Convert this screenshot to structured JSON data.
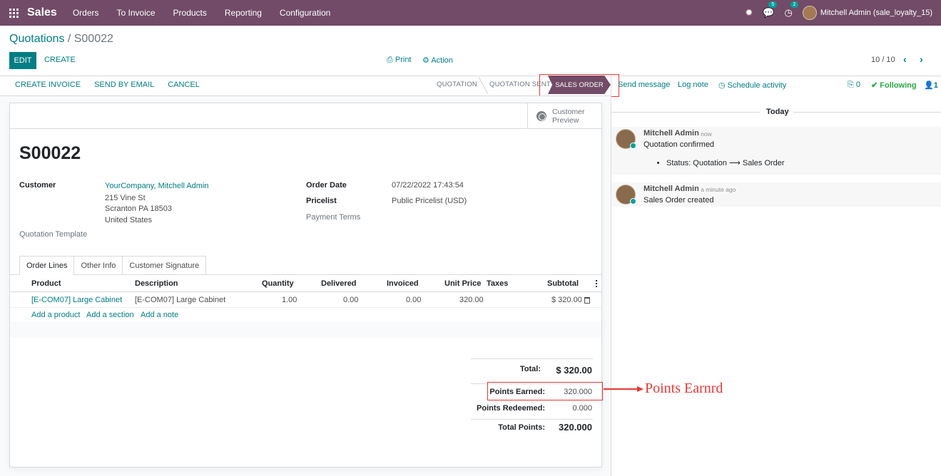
{
  "navbar": {
    "app_name": "Sales",
    "menu": [
      "Orders",
      "To Invoice",
      "Products",
      "Reporting",
      "Configuration"
    ],
    "messages_count": "5",
    "activities_count": "2",
    "user": "Mitchell Admin (sale_loyalty_15)"
  },
  "breadcrumb": {
    "parent": "Quotations",
    "separator": " / ",
    "current": "S00022"
  },
  "control_panel": {
    "edit_label": "EDIT",
    "create_label": "CREATE",
    "print_label": "Print",
    "action_label": "Action",
    "pager": "10 / 10"
  },
  "statusbar": {
    "buttons": [
      "CREATE INVOICE",
      "SEND BY EMAIL",
      "CANCEL"
    ],
    "stages": [
      "QUOTATION",
      "QUOTATION SENT",
      "SALES ORDER"
    ],
    "active_stage": "SALES ORDER"
  },
  "chatter_topbar": {
    "send_message": "Send message",
    "log_note": "Log note",
    "schedule_activity": "Schedule activity",
    "attachments": "0",
    "following": "Following",
    "followers": "1"
  },
  "form": {
    "customer_preview": [
      "Customer",
      "Preview"
    ],
    "title": "S00022",
    "customer_label": "Customer",
    "customer_name": "YourCompany, Mitchell Admin",
    "customer_address": [
      "215 Vine St",
      "Scranton PA 18503",
      "United States"
    ],
    "quotation_template_label": "Quotation Template",
    "order_date_label": "Order Date",
    "order_date": "07/22/2022 17:43:54",
    "pricelist_label": "Pricelist",
    "pricelist": "Public Pricelist (USD)",
    "payment_terms_label": "Payment Terms",
    "tabs": [
      "Order Lines",
      "Other Info",
      "Customer Signature"
    ],
    "columns": [
      "Product",
      "Description",
      "Quantity",
      "Delivered",
      "Invoiced",
      "Unit Price",
      "Taxes",
      "Subtotal"
    ],
    "lines": [
      {
        "product": "[E-COM07] Large Cabinet",
        "description": "[E-COM07] Large Cabinet",
        "quantity": "1.00",
        "delivered": "0.00",
        "invoiced": "0.00",
        "unit_price": "320.00",
        "taxes": "",
        "subtotal": "$ 320.00"
      }
    ],
    "add_links": [
      "Add a product",
      "Add a section",
      "Add a note"
    ],
    "totals": {
      "total_label": "Total:",
      "total_value": "$ 320.00",
      "points_earned_label": "Points Earned:",
      "points_earned_value": "320.000",
      "points_redeemed_label": "Points Redeemed:",
      "points_redeemed_value": "0.000",
      "total_points_label": "Total Points:",
      "total_points_value": "320.000"
    }
  },
  "annotation": {
    "text": "Points Earnrd",
    "color": "#e53935"
  },
  "chatter": {
    "date_separator": "Today",
    "messages": [
      {
        "author": "Mitchell Admin",
        "time": "- now",
        "body": "Quotation confirmed",
        "tracking": "Status: Quotation ⟶ Sales Order"
      },
      {
        "author": "Mitchell Admin",
        "time": "- a minute ago",
        "body": "Sales Order created"
      }
    ]
  },
  "colors": {
    "brand": "#714b67",
    "accent": "#017e84",
    "following": "#28a745",
    "highlight": "#e53935"
  }
}
